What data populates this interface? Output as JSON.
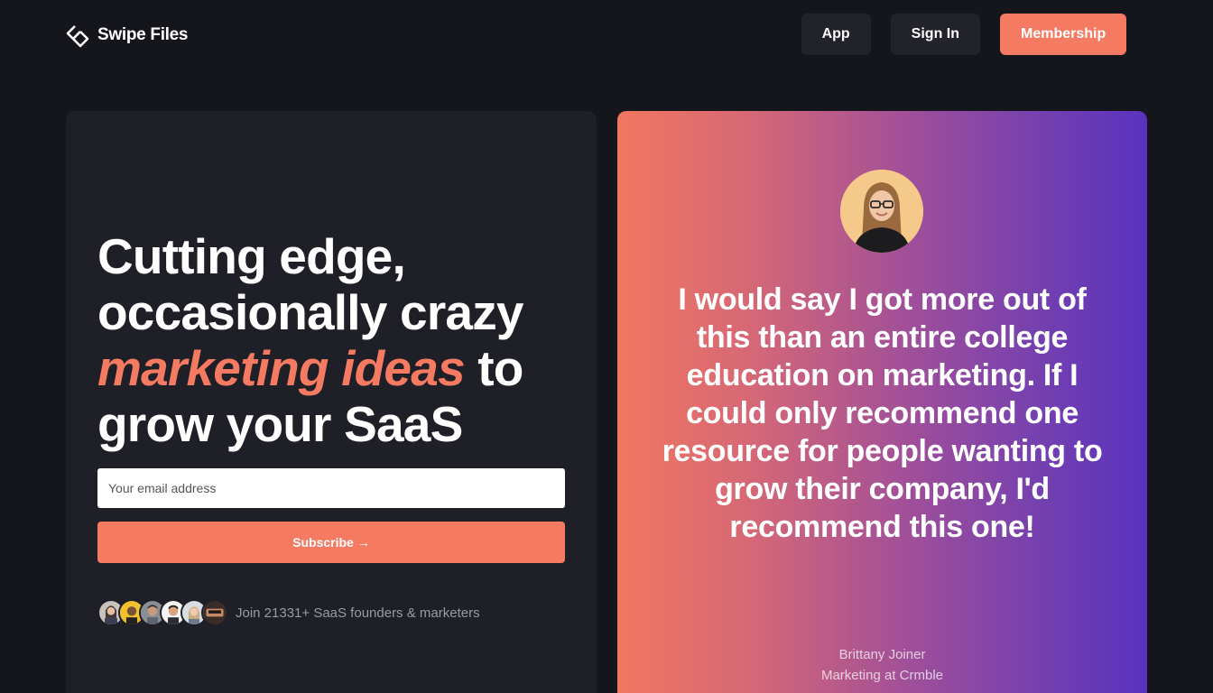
{
  "brand": {
    "name": "Swipe Files",
    "accent": "#f47a62"
  },
  "nav": {
    "app_label": "App",
    "signin_label": "Sign In",
    "membership_label": "Membership"
  },
  "hero": {
    "line1": "Cutting edge,",
    "line2": "occasionally crazy",
    "accent_text": "marketing ideas",
    "line3_rest": " to",
    "line4": "grow your SaaS"
  },
  "signup": {
    "email_placeholder": "Your email address",
    "subscribe_label": "Subscribe",
    "subscribe_arrow": "→",
    "join_text": "Join 21331+ SaaS founders & marketers"
  },
  "testimonial": {
    "quote": "I would say I got more out of this than an entire college education on marketing. If I could only recommend one resource for people wanting to grow their company, I'd recommend this one!",
    "author_name": "Brittany Joiner",
    "author_title": "Marketing at Crmble"
  },
  "colors": {
    "background": "#15151c",
    "card": "#1f1f27",
    "gradient_start": "#f27760",
    "gradient_end": "#5a32be"
  }
}
